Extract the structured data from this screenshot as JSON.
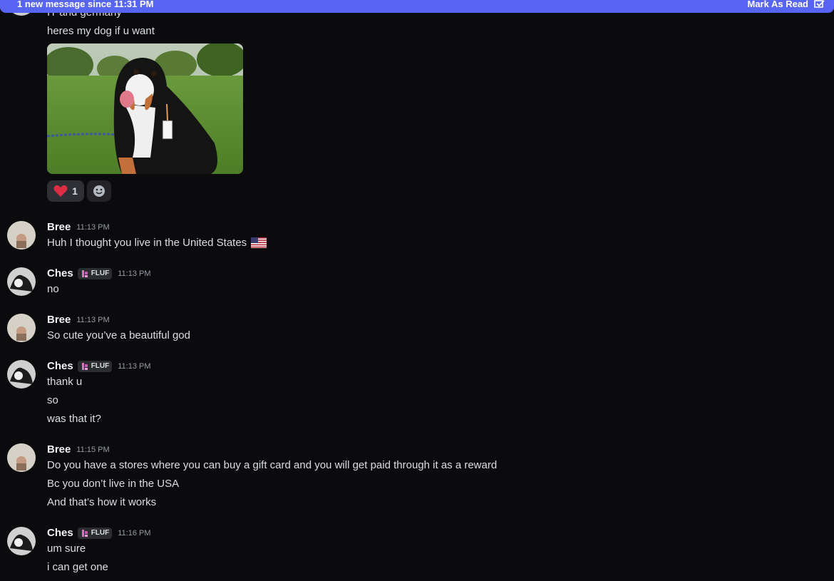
{
  "banner": {
    "new_messages_text": "1 new message since 11:31 PM",
    "mark_as_read_label": "Mark As Read",
    "accent_color": "#5865f2"
  },
  "top_context": {
    "partial_text": "IT and germany",
    "message_text": "heres my dog if u want",
    "image_alt": "Bernese mountain dog sitting on grass",
    "reaction": {
      "emoji_icon": "heart-icon",
      "count": "1"
    },
    "add_reaction_icon": "smiley-icon"
  },
  "messages": [
    {
      "author": "Bree",
      "time": "11:13 PM",
      "lines": [
        "Huh I thought you live in the United States"
      ],
      "flag_icon": "us-flag-icon"
    },
    {
      "author": "Ches",
      "tag": "FLUF",
      "time": "11:13 PM",
      "lines": [
        "no"
      ]
    },
    {
      "author": "Bree",
      "time": "11:13 PM",
      "lines": [
        "So cute you’ve a beautiful god"
      ]
    },
    {
      "author": "Ches",
      "tag": "FLUF",
      "time": "11:13 PM",
      "lines": [
        "thank u",
        "so",
        "was that it?"
      ]
    },
    {
      "author": "Bree",
      "time": "11:15 PM",
      "lines": [
        "Do you have a stores where you can buy a gift card and you will get paid through it as a reward",
        "Bc you don’t live in the USA",
        "And that’s how it works"
      ]
    },
    {
      "author": "Ches",
      "tag": "FLUF",
      "time": "11:16 PM",
      "lines": [
        "um sure",
        "i can get one"
      ]
    }
  ]
}
